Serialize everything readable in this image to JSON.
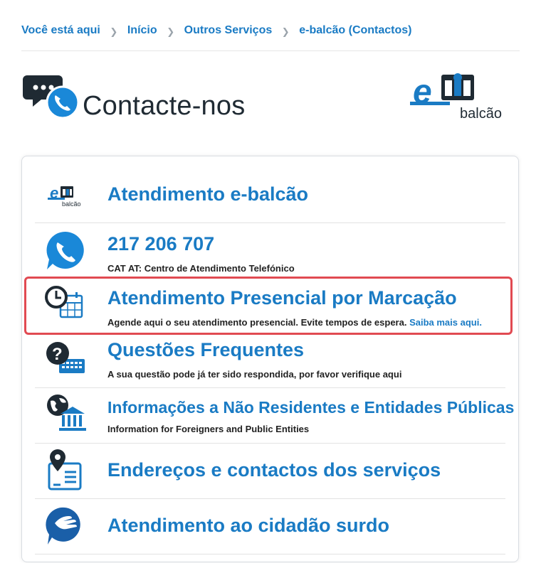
{
  "breadcrumb": {
    "items": [
      "Você está aqui",
      "Início",
      "Outros Serviços",
      "e-balcão (Contactos)"
    ]
  },
  "hero": {
    "title": "Contacte-nos"
  },
  "logo": {
    "e": "e",
    "text": "balcão"
  },
  "colors": {
    "accent": "#1a7bc4",
    "highlight_border": "#e14a52",
    "dark": "#1f2a33"
  },
  "services": [
    {
      "title": "Atendimento e-balcão",
      "icon": "ebalcao-icon"
    },
    {
      "title": "217 206 707",
      "subtitle": "CAT AT: Centro de Atendimento Telefónico",
      "icon": "phone-icon"
    },
    {
      "title": "Atendimento Presencial por Marcação",
      "subtitle": "Agende aqui o seu atendimento presencial. Evite tempos de espera. ",
      "link": "Saiba mais aqui.",
      "icon": "clock-calendar-icon"
    },
    {
      "title": "Questões Frequentes",
      "subtitle": "A sua questão pode já ter sido respondida, por favor verifique aqui",
      "icon": "question-keyboard-icon"
    },
    {
      "title": "Informações a Não Residentes e Entidades Públicas",
      "subtitle": "Information for Foreigners and Public Entities",
      "icon": "globe-building-icon"
    },
    {
      "title": "Endereços e contactos dos serviços",
      "icon": "location-address-icon"
    },
    {
      "title": "Atendimento ao cidadão surdo",
      "icon": "sign-language-icon"
    }
  ]
}
